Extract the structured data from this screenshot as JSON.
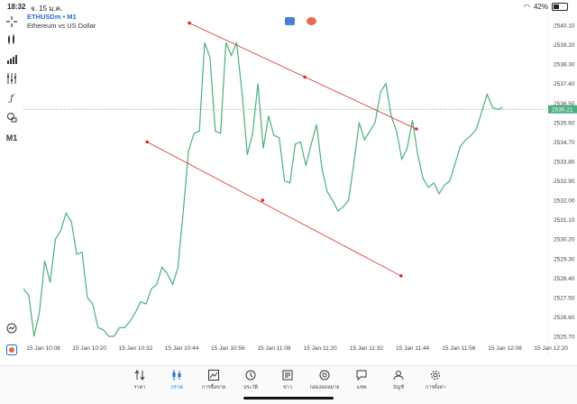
{
  "status": {
    "time": "18:32",
    "date": "จ. 15 ม.ค.",
    "battery": "42%",
    "battery_level": 0.42
  },
  "symbol": {
    "name": "ETHUSDm • M1",
    "description": "Ethereum vs US Dollar"
  },
  "left_tools": [
    "crosshair-icon",
    "indicator-icon",
    "bar-chart-icon",
    "tune-icon",
    "function-icon",
    "objects-icon",
    "timeframe"
  ],
  "timeframe": "M1",
  "chart_data": {
    "type": "line",
    "symbol": "ETHUSDm",
    "timeframe": "M1",
    "y_ticks": [
      "2540.10",
      "2539.20",
      "2538.30",
      "2537.40",
      "2536.50",
      "2535.60",
      "2534.70",
      "2533.80",
      "2532.90",
      "2532.00",
      "2531.10",
      "2530.20",
      "2529.30",
      "2528.40",
      "2527.50",
      "2526.60",
      "2525.70"
    ],
    "x_ticks": [
      "15 Jan 10:08",
      "15 Jan 10:20",
      "15 Jan 10:32",
      "15 Jan 10:44",
      "15 Jan 10:56",
      "15 Jan 11:08",
      "15 Jan 11:20",
      "15 Jan 11:32",
      "15 Jan 11:44",
      "15 Jan 11:56",
      "15 Jan 12:08",
      "15 Jan 12:20"
    ],
    "current_price": "2536.21",
    "ylim": [
      2525.3,
      2540.5
    ],
    "series": [
      {
        "values": [
          2527.9,
          2527.6,
          2525.7,
          2526.8,
          2529.2,
          2528.2,
          2530.2,
          2530.6,
          2531.4,
          2531.0,
          2529.5,
          2529.6,
          2527.5,
          2527.2,
          2526.1,
          2526.0,
          2525.7,
          2525.7,
          2526.1,
          2526.1,
          2526.4,
          2526.8,
          2527.3,
          2527.2,
          2527.9,
          2528.1,
          2528.9,
          2528.6,
          2528.1,
          2528.9,
          2531.5,
          2534.3,
          2535.1,
          2535.2,
          2539.3,
          2538.6,
          2535.2,
          2535.1,
          2539.3,
          2538.7,
          2539.3,
          2537.0,
          2534.1,
          2535.1,
          2537.4,
          2534.4,
          2535.9,
          2535.0,
          2534.9,
          2532.9,
          2532.8,
          2534.6,
          2534.7,
          2533.6,
          2534.6,
          2535.5,
          2533.5,
          2532.4,
          2532.0,
          2531.5,
          2531.7,
          2532.0,
          2533.7,
          2535.6,
          2534.8,
          2535.2,
          2535.6,
          2537.0,
          2537.4,
          2535.9,
          2535.2,
          2533.9,
          2534.4,
          2535.7,
          2534.1,
          2533.0,
          2532.6,
          2532.8,
          2532.3,
          2532.7,
          2532.9,
          2533.7,
          2534.5,
          2534.8,
          2535.0,
          2535.3,
          2536.1,
          2536.9,
          2536.3,
          2536.2,
          2536.3
        ]
      }
    ],
    "trendlines": [
      {
        "name": "upper-channel-line",
        "points": [
          [
            "15 Jan 10:46",
            2540.2
          ],
          [
            "15 Jan 11:16",
            2537.7
          ],
          [
            "15 Jan 11:45",
            2535.3
          ]
        ]
      },
      {
        "name": "lower-channel-line",
        "points": [
          [
            "15 Jan 10:35",
            2534.7
          ],
          [
            "15 Jan 11:05",
            2532.0
          ],
          [
            "15 Jan 11:41",
            2528.5
          ]
        ]
      }
    ],
    "grid": false
  },
  "nav": {
    "items": [
      {
        "icon": "sort-icon",
        "label": "ราคา",
        "active": false
      },
      {
        "icon": "candlestick-icon",
        "label": "กราฟ",
        "active": true
      },
      {
        "icon": "trade-icon",
        "label": "การซื้อขาย",
        "active": false
      },
      {
        "icon": "history-icon",
        "label": "ประวัติ",
        "active": false
      },
      {
        "icon": "news-icon",
        "label": "ข่าว",
        "active": false
      },
      {
        "icon": "at-icon",
        "label": "กล่องจดหมาย",
        "active": false
      },
      {
        "icon": "chat-icon",
        "label": "แชท",
        "active": false
      },
      {
        "icon": "account-icon",
        "label": "บัญชี",
        "active": false
      },
      {
        "icon": "settings-icon",
        "label": "การตั้งค่า",
        "active": false
      }
    ]
  },
  "colors": {
    "line": "#4caf7d",
    "trend": "#d92b2b",
    "price_label": "#4caf7d",
    "accent": "#1e6fd9"
  }
}
